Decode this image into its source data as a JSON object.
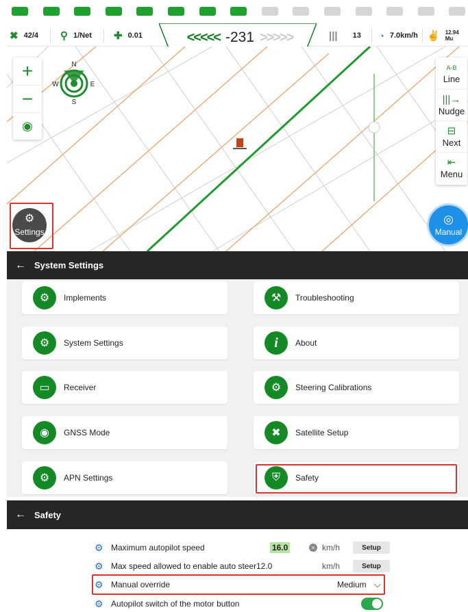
{
  "led_bar": {
    "leds": [
      {
        "state": "on",
        "color": "#1fa12f"
      },
      {
        "state": "on",
        "color": "#1fa12f"
      },
      {
        "state": "on",
        "color": "#1fa12f"
      },
      {
        "state": "on",
        "color": "#1fa12f"
      },
      {
        "state": "on",
        "color": "#1fa12f"
      },
      {
        "state": "on",
        "color": "#1fa12f"
      },
      {
        "state": "on",
        "color": "#1fa12f"
      },
      {
        "state": "on",
        "color": "#1fa12f"
      },
      {
        "state": "off",
        "color": "#d6d6d6"
      },
      {
        "state": "off",
        "color": "#d6d6d6"
      },
      {
        "state": "off",
        "color": "#d6d6d6"
      },
      {
        "state": "off",
        "color": "#d6d6d6"
      },
      {
        "state": "off",
        "color": "#d6d6d6"
      },
      {
        "state": "off",
        "color": "#d6d6d6"
      },
      {
        "state": "off",
        "color": "#d6d6d6"
      }
    ]
  },
  "status_bar": {
    "satellites": "42/4",
    "correction": "1/Net",
    "accuracy": "0.01",
    "guidance": {
      "left_chevrons": "<<<<<",
      "offset": "-231",
      "right_chevrons": ">>>>>"
    },
    "line_number": "13",
    "speed": "7.0km/h",
    "area": "12.94 Mu",
    "icons": [
      "satellite-icon",
      "location-pin-icon",
      "accuracy-icon",
      "swath-icon",
      "speedometer-icon",
      "area-icon"
    ]
  },
  "map": {
    "compass": {
      "n": "N",
      "s": "S",
      "e": "E",
      "w": "W"
    },
    "zoom_in": "+",
    "zoom_out": "−",
    "tools": [
      {
        "label": "Line",
        "glyph": "A-B",
        "icon": "ab-line-icon"
      },
      {
        "label": "Nudge",
        "glyph": "|||→",
        "icon": "nudge-icon"
      },
      {
        "label": "Next",
        "glyph": "⊟",
        "icon": "next-line-icon"
      },
      {
        "label": "Menu",
        "glyph": "⇤",
        "icon": "menu-icon"
      }
    ],
    "settings_label": "Settings",
    "manual_label": "Manual",
    "colors": {
      "guide_line": "#1f9a2d",
      "swath_line": "#f0a26a",
      "grid_line": "#c9c9c9"
    }
  },
  "system_settings": {
    "title": "System Settings",
    "items": [
      {
        "label": "Implements",
        "icon": "implement-icon",
        "glyph": "⚙"
      },
      {
        "label": "Troubleshooting",
        "icon": "wrench-gear-icon",
        "glyph": "🔧"
      },
      {
        "label": "System Settings",
        "icon": "gear-icon",
        "glyph": "⚙"
      },
      {
        "label": "About",
        "icon": "info-icon",
        "glyph": "i"
      },
      {
        "label": "Receiver",
        "icon": "receiver-icon",
        "glyph": "▭"
      },
      {
        "label": "Steering Calibrations",
        "icon": "steering-gear-icon",
        "glyph": "⚙"
      },
      {
        "label": "GNSS Mode",
        "icon": "gnss-icon",
        "glyph": "◉"
      },
      {
        "label": "Satellite Setup",
        "icon": "satellite-icon",
        "glyph": "✕"
      },
      {
        "label": "APN Settings",
        "icon": "apn-gear-icon",
        "glyph": "⚙"
      },
      {
        "label": "Safety",
        "icon": "shield-icon",
        "glyph": "⛨"
      }
    ]
  },
  "safety": {
    "title": "Safety",
    "rows": [
      {
        "label": "Maximum autopilot speed",
        "value": "16.0",
        "unit": "km/h",
        "button": "Setup"
      },
      {
        "label": "Max speed allowed to enable auto steer...",
        "value": "12.0",
        "unit": "km/h",
        "button": "Setup"
      },
      {
        "label": "Manual override",
        "value": "Medium"
      },
      {
        "label": "Autopilot switch of the motor button",
        "toggle": true
      }
    ]
  }
}
